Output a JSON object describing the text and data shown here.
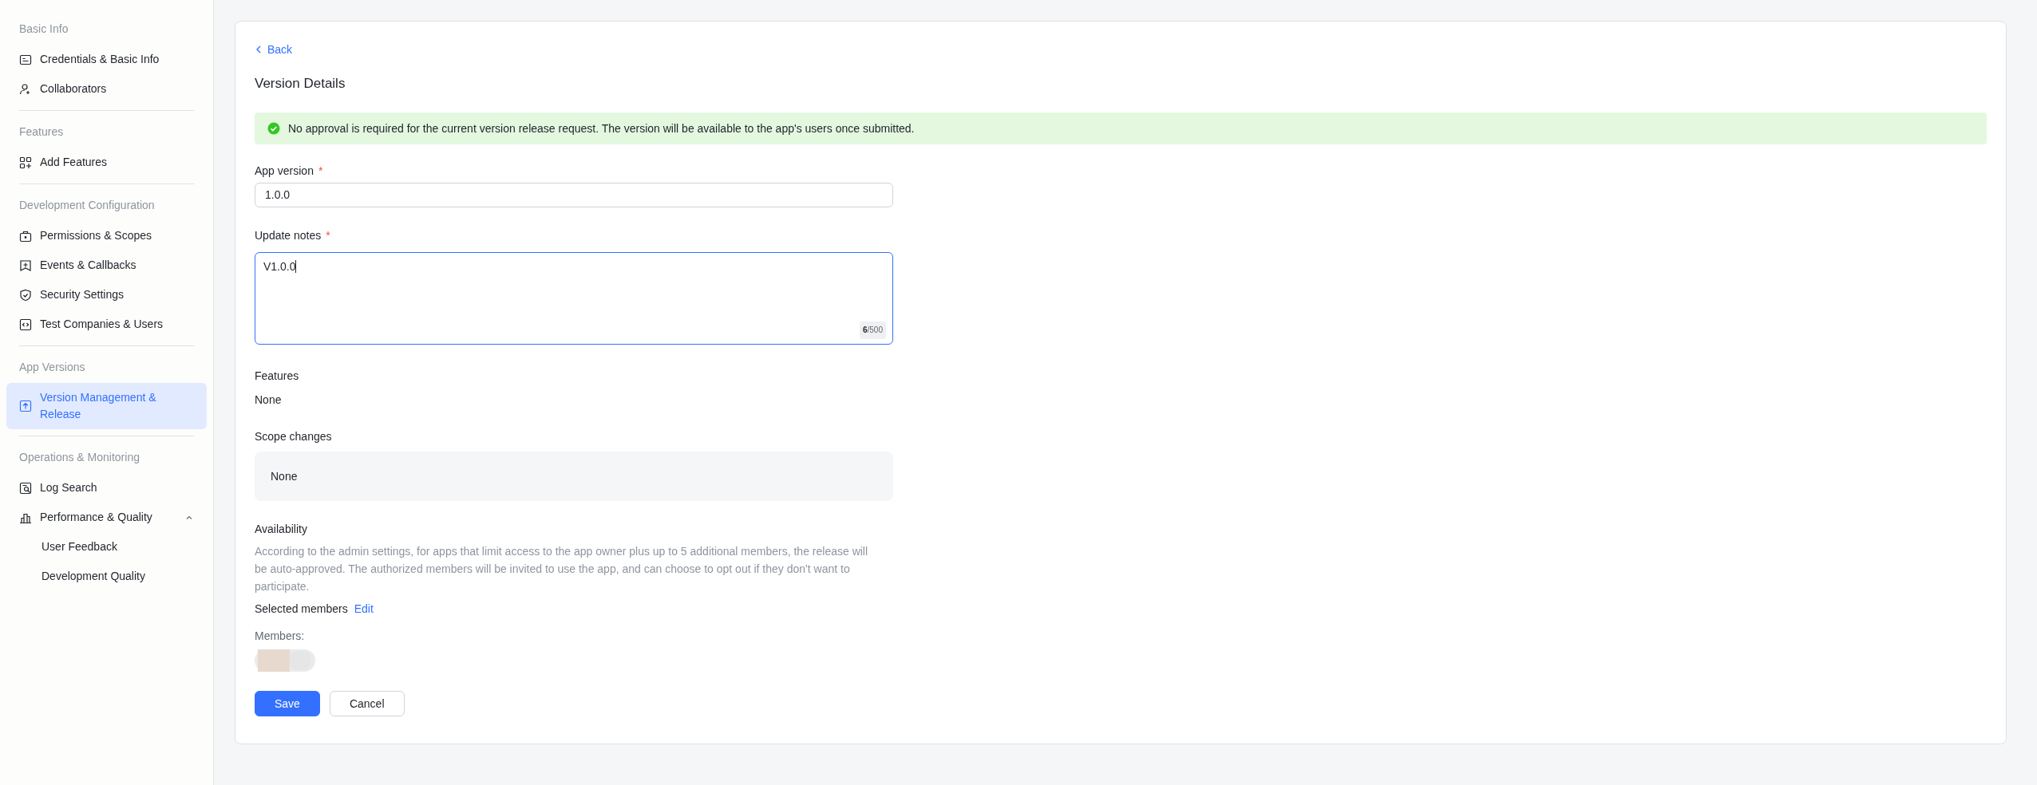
{
  "sidebar": {
    "sections": [
      {
        "title": "Basic Info",
        "items": [
          {
            "label": "Credentials & Basic Info",
            "kind": "card",
            "selected": false
          },
          {
            "label": "Collaborators",
            "kind": "user-add",
            "selected": false
          }
        ]
      },
      {
        "title": "Features",
        "items": [
          {
            "label": "Add Features",
            "kind": "grid-add",
            "selected": false
          }
        ]
      },
      {
        "title": "Development Configuration",
        "items": [
          {
            "label": "Permissions & Scopes",
            "kind": "briefcase",
            "selected": false
          },
          {
            "label": "Events & Callbacks",
            "kind": "event",
            "selected": false
          },
          {
            "label": "Security Settings",
            "kind": "shield",
            "selected": false
          },
          {
            "label": "Test Companies & Users",
            "kind": "code",
            "selected": false
          }
        ]
      },
      {
        "title": "App Versions",
        "items": [
          {
            "label": "Version Management & Release",
            "kind": "upload",
            "selected": true
          }
        ]
      },
      {
        "title": "Operations & Monitoring",
        "items": [
          {
            "label": "Log Search",
            "kind": "log",
            "selected": false
          },
          {
            "label": "Performance & Quality",
            "kind": "chart",
            "selected": false,
            "expanded": true,
            "children": [
              {
                "label": "User Feedback",
                "selected": false
              },
              {
                "label": "Development Quality",
                "selected": false
              }
            ]
          }
        ]
      }
    ]
  },
  "main": {
    "back": "Back",
    "title": "Version Details",
    "notice": "No approval is required for the current version release request. The version will be available to the app's users once submitted.",
    "app_version": {
      "label": "App version",
      "required_mark": "*",
      "value": "1.0.0"
    },
    "update_notes": {
      "label": "Update notes",
      "required_mark": "*",
      "value": "V1.0.0",
      "count": "6",
      "max": "/500"
    },
    "features": {
      "label": "Features",
      "value": "None"
    },
    "scope_changes": {
      "label": "Scope changes",
      "value": "None"
    },
    "availability": {
      "label": "Availability",
      "description": "According to the admin settings, for apps that limit access to the app owner plus up to 5 additional members, the release will be auto-approved. The authorized members will be invited to use the app, and can choose to opt out if they don't want to participate."
    },
    "selected_members": {
      "label": "Selected members",
      "edit": "Edit"
    },
    "members": {
      "label": "Members:"
    },
    "buttons": [
      {
        "label": "Save",
        "kind": "primary"
      },
      {
        "label": "Cancel",
        "kind": "secondary"
      }
    ]
  }
}
